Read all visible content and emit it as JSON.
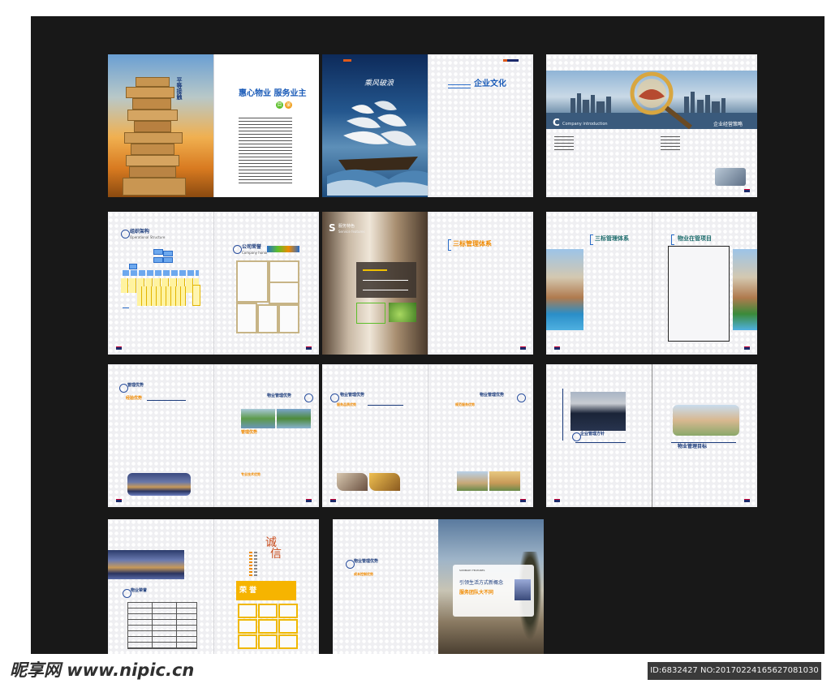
{
  "spread1": {
    "vertical_title": "平等接触",
    "headline": "惠心物业  服务业主",
    "toc_labels": [
      "目",
      "录"
    ]
  },
  "spread2": {
    "calligraphy": "乘风破浪",
    "title": "企业文化"
  },
  "spread3": {
    "intro_letter": "C",
    "intro_en": "Company introduction",
    "banner_label": "企业经营策略"
  },
  "spread4": {
    "org_title": "组织架构",
    "org_en": "Operational Structure",
    "honor_title": "公司荣誉",
    "honor_en": "Company honor"
  },
  "spread5": {
    "service_letter": "S",
    "service_title": "服务特色",
    "service_en": "Service features",
    "system_title": "三标管理体系"
  },
  "spread6": {
    "system_title": "三标管理体系",
    "projects_title": "物业在管项目"
  },
  "spread7": {
    "mgmt_adv": "管理优势",
    "experience_adv": "经验优势",
    "property_mgmt_adv": "物业管理优势",
    "env_adv": "管理优势",
    "tech_adv": "专业技术优势"
  },
  "spread8": {
    "property_mgmt_adv_left": "物业管理优势",
    "service_quality": "服务品质优势",
    "property_mgmt_adv_right": "物业管理优势",
    "quality_adv": "规范服务优势"
  },
  "spread9": {
    "policy_title": "企业管理方针",
    "goal_title": "物业管理目标"
  },
  "spread10": {
    "property_honor": "物业荣誉",
    "integrity_chars": [
      "诚",
      "信"
    ],
    "honor_label": "荣  誉"
  },
  "spread11": {
    "adv_title": "物业管理优势",
    "cost_adv": "成本控制优势",
    "card_en": "SUMMARY FEATURES",
    "card_line1": "引领生活方式新概念",
    "card_line2": "服务团队大不同"
  },
  "watermark": {
    "brand": "昵享网 www.nipic.cn",
    "id_text": "ID:6832427 NO:20170224165627081030"
  },
  "colors": {
    "accent_blue": "#1a5bb8",
    "accent_orange": "#f08a00",
    "backdrop": "#181818"
  }
}
